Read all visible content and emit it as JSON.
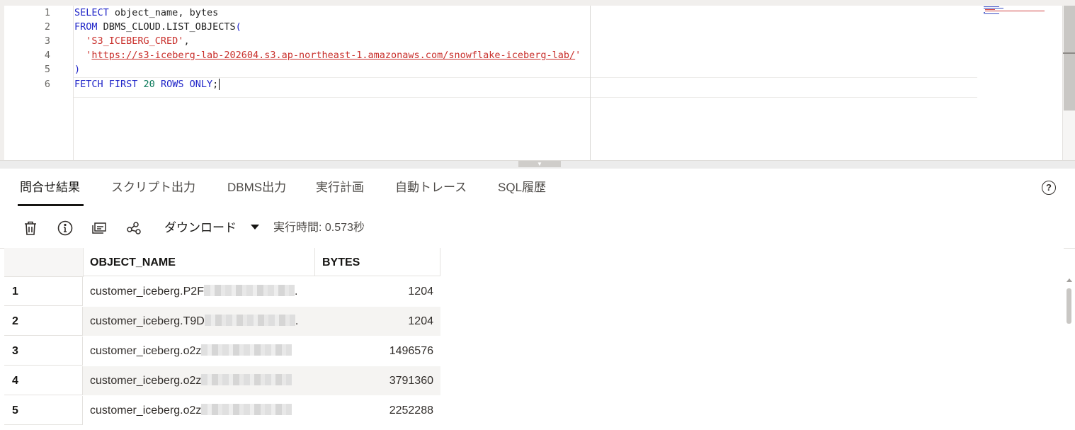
{
  "editor": {
    "line_numbers": [
      "1",
      "2",
      "3",
      "4",
      "5",
      "6"
    ],
    "code": {
      "l1_kw": "SELECT",
      "l1_rest": " object_name, bytes",
      "l2_kw": "FROM",
      "l2_rest": " DBMS_CLOUD.LIST_OBJECTS",
      "l2_paren": "(",
      "l3_str": "'S3_ICEBERG_CRED'",
      "l3_comma": ",",
      "l4_q1": "'",
      "l4_url": "https://s3-iceberg-lab-202604.s3.ap-northeast-1.amazonaws.com/snowflake-iceberg-lab/",
      "l4_q2": "'",
      "l5_paren": ")",
      "l6_kw1": "FETCH FIRST",
      "l6_num": "20",
      "l6_kw2": "ROWS ONLY",
      "l6_semi": ";"
    }
  },
  "tabs": [
    {
      "label": "問合せ結果",
      "active": true
    },
    {
      "label": "スクリプト出力"
    },
    {
      "label": "DBMS出力"
    },
    {
      "label": "実行計画"
    },
    {
      "label": "自動トレース"
    },
    {
      "label": "SQL履歴"
    }
  ],
  "help_label": "?",
  "toolbar": {
    "icons": [
      "trash-icon",
      "info-icon",
      "single-record-view-icon",
      "share-icon"
    ],
    "download_label": "ダウンロード",
    "exec_time": "実行時間: 0.573秒"
  },
  "grid": {
    "columns": [
      "OBJECT_NAME",
      "BYTES"
    ],
    "rows": [
      {
        "num": "1",
        "name": "customer_iceberg.P2F",
        "tail": ".",
        "bytes": "1204"
      },
      {
        "num": "2",
        "name": "customer_iceberg.T9D",
        "tail": ".",
        "bytes": "1204"
      },
      {
        "num": "3",
        "name": "customer_iceberg.o2z",
        "tail": "",
        "bytes": "1496576"
      },
      {
        "num": "4",
        "name": "customer_iceberg.o2z",
        "tail": "",
        "bytes": "3791360"
      },
      {
        "num": "5",
        "name": "customer_iceberg.o2z",
        "tail": "",
        "bytes": "2252288"
      }
    ]
  },
  "colors": {
    "keyword": "#1f24c8",
    "string": "#c9302c",
    "accent": "#161513"
  }
}
